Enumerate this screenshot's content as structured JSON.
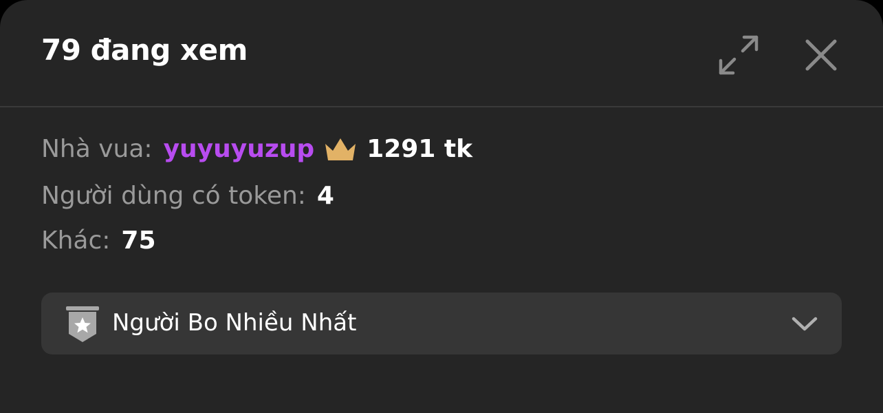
{
  "header": {
    "title": "79 đang xem",
    "expand_icon": "expand-arrows-icon",
    "close_icon": "close-icon"
  },
  "stats": {
    "king": {
      "label": "Nhà vua:",
      "username": "yuyuyuzup",
      "crown_icon": "crown-icon",
      "amount": "1291 tk"
    },
    "token_users": {
      "label": "Người dùng có token:",
      "value": "4"
    },
    "others": {
      "label": "Khác:",
      "value": "75"
    }
  },
  "dropdown": {
    "icon": "star-badge-icon",
    "label": "Người Bo Nhiều Nhất",
    "chevron_icon": "chevron-down-icon"
  },
  "colors": {
    "background": "#252525",
    "username": "#b84cf0",
    "crown": "#e2b266",
    "label": "#9a9a9a",
    "value": "#ffffff",
    "dropdown_bg": "#363636"
  }
}
